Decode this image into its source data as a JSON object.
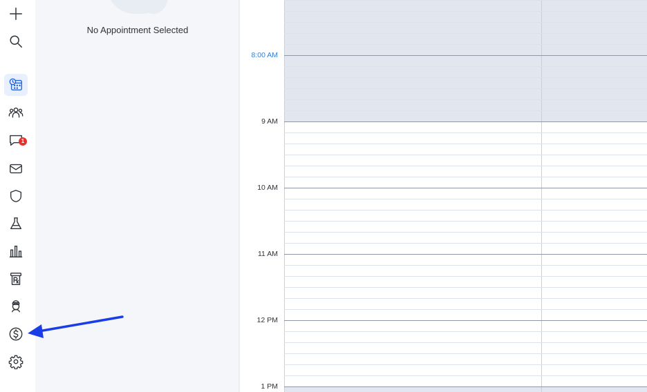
{
  "sidebar": {
    "items": [
      {
        "name": "new-item-button",
        "icon": "plus-icon"
      },
      {
        "name": "search-button",
        "icon": "search-icon"
      },
      {
        "name": "calendar-button",
        "icon": "calendar-clock-icon",
        "active": true
      },
      {
        "name": "patients-button",
        "icon": "people-icon"
      },
      {
        "name": "messages-button",
        "icon": "chat-icon",
        "badge": "1"
      },
      {
        "name": "mail-button",
        "icon": "mail-icon"
      },
      {
        "name": "insurance-button",
        "icon": "shield-icon"
      },
      {
        "name": "labs-button",
        "icon": "flask-icon"
      },
      {
        "name": "reports-button",
        "icon": "bar-chart-icon"
      },
      {
        "name": "prescriptions-button",
        "icon": "rx-icon"
      },
      {
        "name": "providers-button",
        "icon": "doctor-icon"
      },
      {
        "name": "billing-button",
        "icon": "dollar-icon"
      },
      {
        "name": "settings-button",
        "icon": "gear-icon"
      }
    ],
    "messages_badge": "1"
  },
  "appointment_panel": {
    "empty_text": "No Appointment Selected"
  },
  "calendar": {
    "current_time": "8:00 AM",
    "hours": [
      "9 AM",
      "10 AM",
      "11 AM",
      "12 PM",
      "1 PM"
    ],
    "closed_color": "#e2e7ef",
    "current_time_color": "#2f7fd8"
  },
  "annotation": {
    "arrow_color": "#1a3de8",
    "points_to": "billing-button"
  }
}
